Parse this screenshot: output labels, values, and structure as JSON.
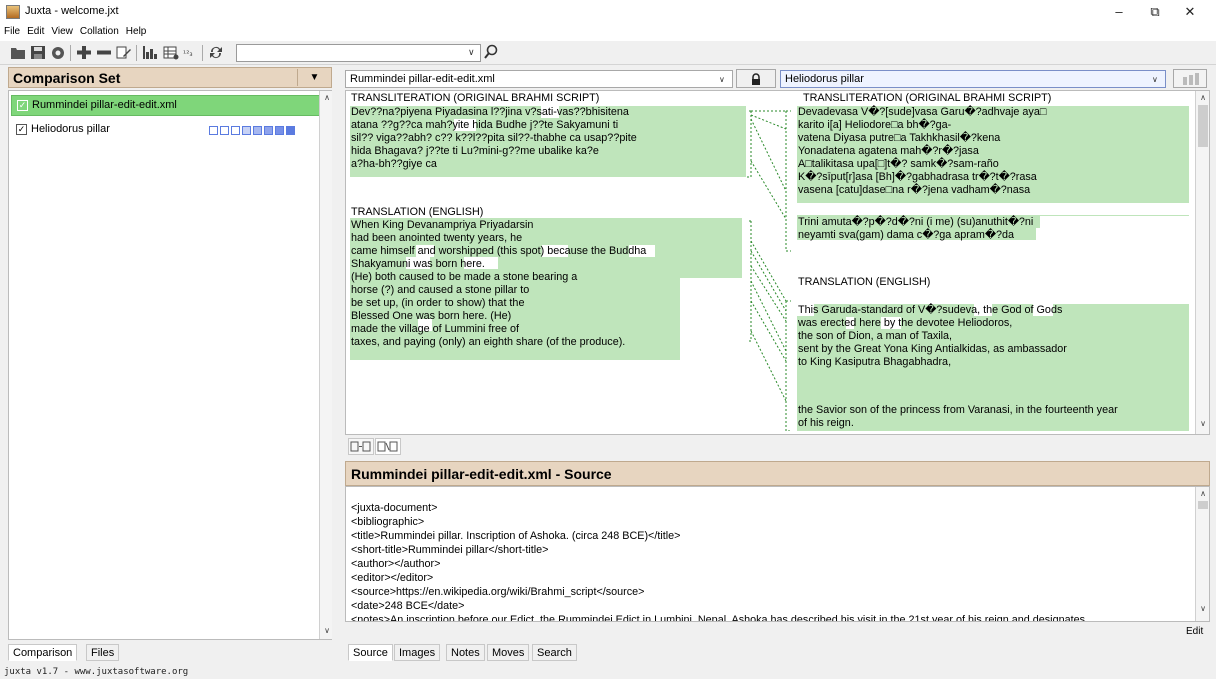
{
  "window": {
    "title": "Juxta - welcome.jxt",
    "minimize": "–",
    "maximize": "⧉",
    "close": "✕"
  },
  "menu": [
    "File",
    "Edit",
    "View",
    "Collation",
    "Help"
  ],
  "toolbar": {
    "icons": [
      "open-folder-icon",
      "save-icon",
      "collate-icon",
      "add-icon",
      "remove-icon",
      "edit-icon",
      "histogram-icon",
      "table-icon",
      "numbered-list-icon",
      "refresh-icon"
    ],
    "search_value": "",
    "search_arrow": "∨",
    "search_icon": "magnifier"
  },
  "left": {
    "header": "Comparison Set",
    "header_menu": "▼",
    "documents": [
      {
        "name": "Rummindei pillar-edit-edit.xml",
        "checked": true,
        "selected": true
      },
      {
        "name": "Heliodorus pillar",
        "checked": true,
        "selected": false
      }
    ],
    "check_mark": "☑",
    "tabs": [
      "Comparison",
      "Files"
    ]
  },
  "comparison": {
    "left_doc": "Rummindei pillar-edit-edit.xml",
    "right_doc": "Heliodorus pillar",
    "lock_icon": "🔒",
    "dd_arrow": "∨",
    "left_text": {
      "h1": "TRANSLITERATION (ORIGINAL BRAHMI SCRIPT)",
      "t1": [
        "Dev??na?piyena Piyadasina l??jina v?sati-vas??bhisitena",
        " atana ??g??ca mah?yite hida Budhe j??te Sakyamuni ti",
        " sil?? viga??abh? c?? k??l??pita sil??-thabhe ca usap??pite",
        " hida Bhagava? j??te ti Lu?mini-g??me ubalike ka?e",
        " a?ha-bh??giye ca"
      ],
      "h2": "TRANSLATION (ENGLISH)",
      "t2": [
        " When King Devanampriya Priyadarsin",
        " had been anointed twenty years, he",
        " came himself and worshipped (this spot) because the Buddha",
        "Shakyamuni was born here.",
        " (He) both caused to be made a stone bearing a",
        " horse (?) and caused a stone pillar to",
        " be set up, (in order to show) that the",
        " Blessed One was born here. (He)",
        " made the village of Lummini free of",
        " taxes, and paying (only) an eighth share (of the produce)."
      ]
    },
    "right_text": {
      "h1": "TRANSLITERATION (ORIGINAL BRAHMI SCRIPT)",
      "t1": [
        "Devadevasa V�?[sude]vasa Garu�?adhvaje aya□",
        " karito i[a] Heliodore□a bh�?ga-",
        " vatena Diyasa putre□a Takhkhasil�?kena",
        " Yonadatena agatena mah�?r�?jasa",
        " A□talikitasa upa[□]t�? samk�?sam-raño",
        " K�?sīput[r]asa [Bh]�?gabhadrasa tr�?t�?rasa",
        " vasena [catu]dase□na r�?jena vadham�?nasa",
        "",
        " Trini amuta�?p�?d�?ni (i me) (su)anuthit�?ni",
        " neyamti sva(gam) dama c�?ga apram�?da"
      ],
      "h2": "TRANSLATION (ENGLISH)",
      "t2": [
        "This Garuda-standard of V�?sudeva, the God of Gods",
        " was erected here by the devotee Heliodoros,",
        " the son of Dion, a man of Taxila,",
        " sent by the Great Yona King Antialkidas, as ambassador",
        " to King Kasiputra Bhagabhadra,",
        "",
        "",
        "",
        "the Savior son of the princess from Varanasi, in the fourteenth year",
        " of his reign."
      ]
    }
  },
  "source": {
    "header": "Rummindei pillar-edit-edit.xml - Source",
    "lines": [
      "<juxta-document>",
      "<bibliographic>",
      "<title>Rummindei pillar. Inscription of Ashoka. (circa 248 BCE)</title>",
      "<short-title>Rummindei pillar</short-title>",
      "<author></author>",
      "<editor></editor>",
      "<source>https://en.wikipedia.org/wiki/Brahmi_script</source>",
      "<date>248 BCE</date>",
      "<notes>An inscription before our Edict, the Rummindei Edict in Lumbini, Nepal. Ashoka has described his visit in the 21st year of his reign and designates"
    ],
    "edit": "Edit",
    "tabs": [
      "Source",
      "Images",
      "Notes",
      "Moves",
      "Search"
    ]
  },
  "status": "juxta v1.7 - www.juxtasoftware.org",
  "colors": {
    "match_green": "#bfe5bb",
    "selected_row": "#7fd67a",
    "header_tan": "#e7d5c0",
    "change_blue": "#5b7be0"
  }
}
